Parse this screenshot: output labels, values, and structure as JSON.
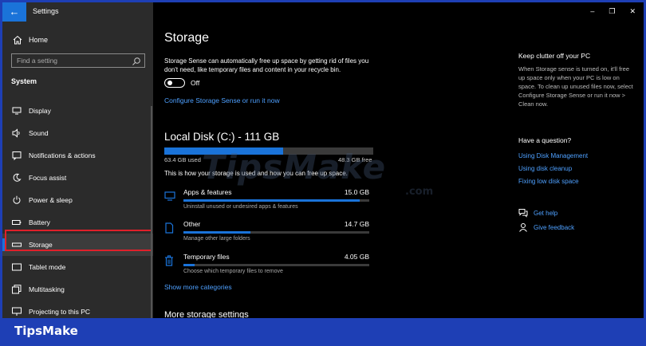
{
  "window": {
    "title": "Settings",
    "controls": [
      "–",
      "❐",
      "✕"
    ]
  },
  "sidebar": {
    "home_label": "Home",
    "search_placeholder": "Find a setting",
    "section": "System",
    "items": [
      {
        "label": "Display",
        "icon": "display-icon"
      },
      {
        "label": "Sound",
        "icon": "sound-icon"
      },
      {
        "label": "Notifications & actions",
        "icon": "notifications-icon"
      },
      {
        "label": "Focus assist",
        "icon": "focus-assist-icon"
      },
      {
        "label": "Power & sleep",
        "icon": "power-icon"
      },
      {
        "label": "Battery",
        "icon": "battery-icon"
      },
      {
        "label": "Storage",
        "icon": "storage-icon",
        "active": true
      },
      {
        "label": "Tablet mode",
        "icon": "tablet-icon"
      },
      {
        "label": "Multitasking",
        "icon": "multitasking-icon"
      },
      {
        "label": "Projecting to this PC",
        "icon": "projecting-icon"
      }
    ]
  },
  "main": {
    "title": "Storage",
    "storage_sense_desc": "Storage Sense can automatically free up space by getting rid of files you don't need, like temporary files and content in your recycle bin.",
    "toggle_label": "Off",
    "configure_link": "Configure Storage Sense or run it now",
    "disk": {
      "title": "Local Disk (C:) - 111 GB",
      "used": "63.4 GB used",
      "free": "48.3 GB free",
      "used_fraction": 0.57
    },
    "how_text": "This is how your storage is used and how you can free up space.",
    "categories": [
      {
        "name": "Apps & features",
        "size": "15.0 GB",
        "desc": "Uninstall unused or undesired apps & features",
        "fraction": 0.95,
        "icon": "apps-icon"
      },
      {
        "name": "Other",
        "size": "14.7 GB",
        "desc": "Manage other large folders",
        "fraction": 0.36,
        "icon": "other-icon"
      },
      {
        "name": "Temporary files",
        "size": "4.05 GB",
        "desc": "Choose which temporary files to remove",
        "fraction": 0.06,
        "icon": "trash-icon"
      }
    ],
    "show_more": "Show more categories",
    "more_settings": "More storage settings"
  },
  "rail": {
    "clutter_title": "Keep clutter off your PC",
    "clutter_desc": "When Storage sense is turned on, it'll free up space only when your PC is low on space. To clean up unused files now, select Configure Storage Sense or run it now > Clean now.",
    "question_title": "Have a question?",
    "links": [
      "Using Disk Management",
      "Using disk cleanup",
      "Fixing low disk space"
    ],
    "get_help": "Get help",
    "give_feedback": "Give feedback"
  },
  "watermark": {
    "main": "TipsMake",
    "sub": ".com"
  },
  "brand": "TipsMake",
  "colors": {
    "accent": "#1a73d9",
    "link": "#4ea0ff",
    "highlight": "#e0202a",
    "frame": "#1e3fb5"
  }
}
